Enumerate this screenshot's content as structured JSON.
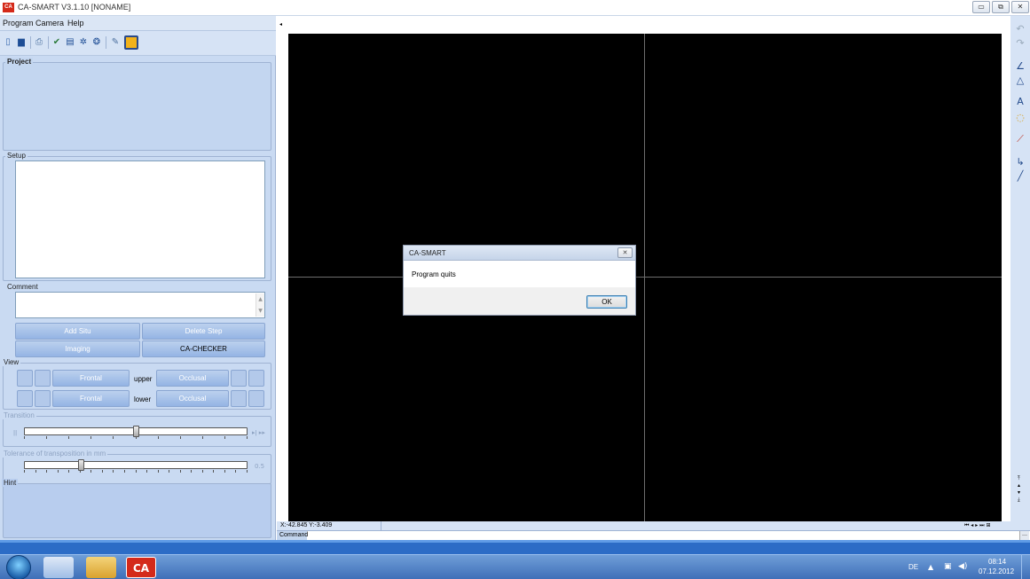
{
  "window": {
    "title": "CA-SMART V3.1.10 [NONAME]",
    "logo_text": "CA",
    "minimize": "▭",
    "restore": "⧉",
    "close": "✕"
  },
  "menu": [
    "Program",
    "Camera",
    "Help"
  ],
  "toolbar_icons": [
    "new-icon",
    "save-icon",
    "print-icon",
    "tools-icon",
    "film-icon",
    "settings-icon",
    "help-icon",
    "edit-icon",
    "frame-icon"
  ],
  "panel": {
    "project_label": "Project",
    "setup_label": "Setup",
    "comment_label": "Comment",
    "buttons": {
      "add_situ": "Add Situ",
      "delete_step": "Delete Step",
      "imaging": "Imaging",
      "ca_checker": "CA-CHECKER"
    },
    "view_label": "View",
    "view_rows": [
      {
        "left": "Frontal",
        "label": "upper",
        "right": "Occlusal"
      },
      {
        "left": "Frontal",
        "label": "lower",
        "right": "Occlusal"
      }
    ],
    "transition_label": "Transition",
    "transition_value": 0.5,
    "tolerance_label": "Tolerance of transposition in mm",
    "tolerance_value": "0.5",
    "hint_label": "Hint"
  },
  "dialog": {
    "title": "CA-SMART",
    "message": "Program quits",
    "ok_label": "OK",
    "close_glyph": "✕"
  },
  "status": {
    "coords": "X:-42.845 Y:-3.409",
    "command_label": "Command"
  },
  "taskbar": {
    "tray_lang": "DE",
    "time": "08:14",
    "date": "07.12.2012"
  }
}
